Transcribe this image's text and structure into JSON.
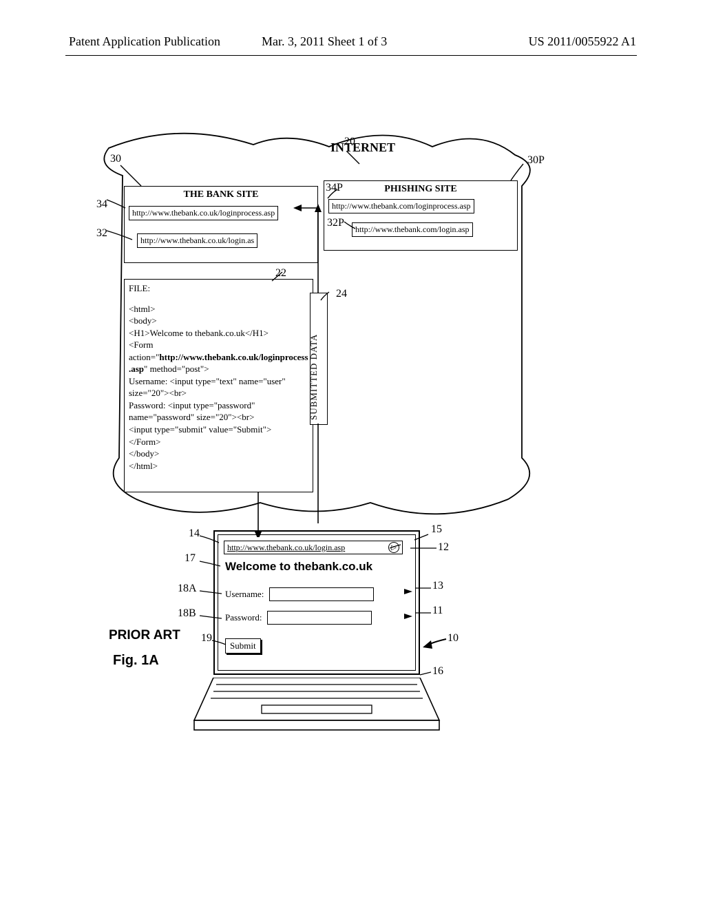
{
  "header": {
    "left": "Patent Application Publication",
    "center": "Mar. 3, 2011  Sheet 1 of 3",
    "right": "US 2011/0055922 A1"
  },
  "cloud": {
    "label": "INTERNET"
  },
  "callouts": {
    "c20": "20",
    "c30": "30",
    "c30P": "30P",
    "c34": "34",
    "c32": "32",
    "c34P": "34P",
    "c32P": "32P",
    "c22": "22",
    "c24": "24",
    "c14": "14",
    "c15": "15",
    "c12": "12",
    "c17": "17",
    "c18A": "18A",
    "c18B": "18B",
    "c13": "13",
    "c11": "11",
    "c19": "19",
    "c10": "10",
    "c16": "16"
  },
  "bank": {
    "title": "THE BANK SITE",
    "url_process": "http://www.thebank.co.uk/loginprocess.asp",
    "url_login": "http://www.thebank.co.uk/login.as"
  },
  "phish": {
    "title": "PHISHING SITE",
    "url_process": "http://www.thebank.com/loginprocess.asp",
    "url_login": "http://www.thebank.com/login.asp"
  },
  "file": {
    "title": "FILE:",
    "l1": "<html>",
    "l2": "<body>",
    "l3": "<H1>Welcome to thebank.co.uk</H1>",
    "l4a": "<Form",
    "l4b": "action=\"",
    "l4c": "http://www.thebank.co.uk/loginprocess.asp",
    "l4d": "\" method=\"post\">",
    "l5": "Username:  <input type=\"text\" name=\"user\" size=\"20\"><br>",
    "l6": "Password:  <input type=\"password\" name=\"password\" size=\"20\"><br>",
    "l7": "<input type=\"submit\" value=\"Submit\">",
    "l8": "</Form>",
    "l9": "</body>",
    "l10": "</html>"
  },
  "submitted": {
    "label": "SUBMITTED DATA"
  },
  "browser": {
    "address": "http://www.thebank.co.uk/login.asp",
    "welcome": "Welcome to thebank.co.uk",
    "username_label": "Username:",
    "password_label": "Password:",
    "submit": "Submit"
  },
  "labels": {
    "prior_art": "PRIOR ART",
    "figure": "Fig. 1A"
  }
}
